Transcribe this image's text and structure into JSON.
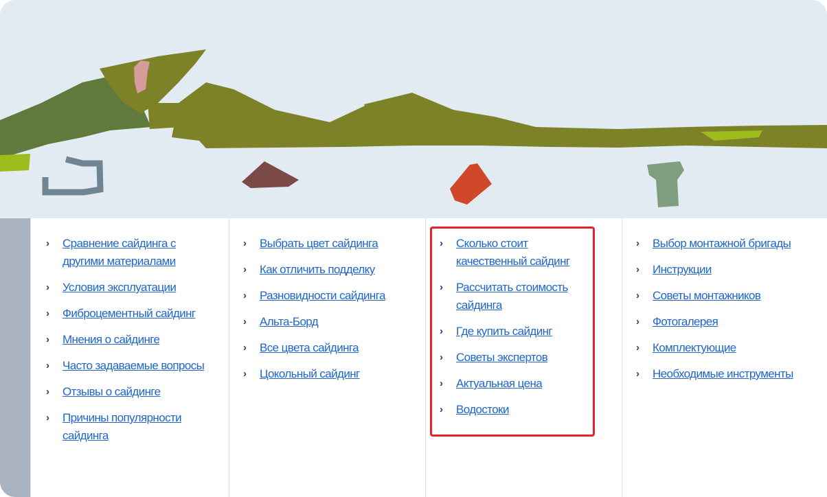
{
  "banner": {
    "colors": {
      "sky": "#e3ebf2",
      "olive": "#7d8127",
      "dark_green": "#5f7a3c",
      "pink": "#d69b9b",
      "lime": "#9dbb1a",
      "gray_blue": "#6f8594",
      "brown": "#7b4a47",
      "red_orange": "#d0472a",
      "sage": "#7f9e7f"
    }
  },
  "menu": {
    "bullet_icon": "chevron-right-icon",
    "columns": [
      {
        "items": [
          "Сравнение сайдинга с другими материалами",
          "Условия эксплуатации",
          "Фиброцементный сайдинг",
          "Мнения о сайдинге",
          "Часто задаваемые вопросы",
          "Отзывы о сайдинге",
          "Причины популярности сайдинга"
        ]
      },
      {
        "items": [
          "Выбрать цвет сайдинга",
          "Как отличить подделку",
          "Разновидности сайдинга",
          "Альта-Борд",
          "Все цвета сайдинга",
          "Цокольный сайдинг"
        ]
      },
      {
        "items": [
          "Сколько стоит качественный сайдинг",
          "Рассчитать стоимость сайдинга",
          "Где купить сайдинг",
          "Советы экспертов",
          "Актуальная цена",
          "Водостоки"
        ]
      },
      {
        "items": [
          "Выбор монтажной бригады",
          "Инструкции",
          "Советы монтажников",
          "Фотогалерея",
          "Комплектующие",
          "Необходимые инструменты"
        ]
      }
    ],
    "highlight_color": "#e3222a",
    "link_color": "#1f66c8"
  }
}
